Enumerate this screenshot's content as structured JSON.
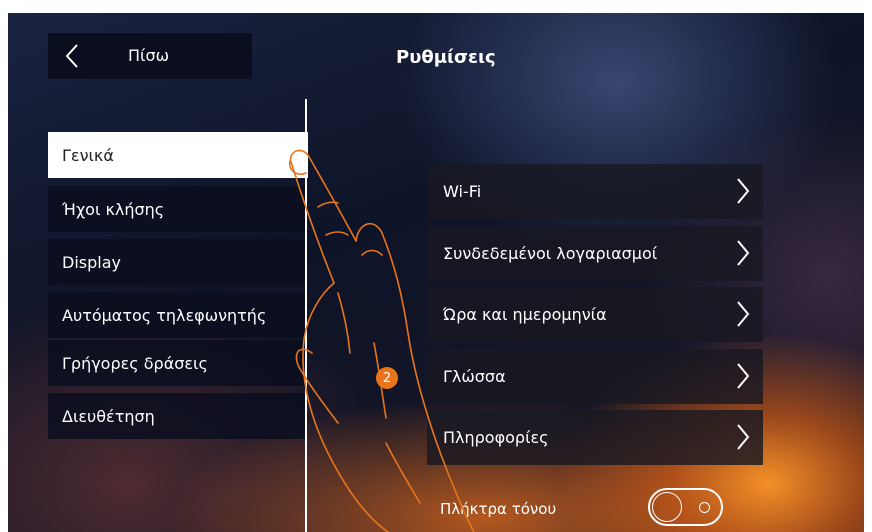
{
  "header": {
    "back_label": "Πίσω",
    "title": "Ρυθμίσεις"
  },
  "sidebar": {
    "items": [
      {
        "label": "Γενικά",
        "active": true
      },
      {
        "label": "Ήχοι κλήσης",
        "active": false
      },
      {
        "label": "Display",
        "active": false
      },
      {
        "label": "Αυτόματος τηλεφωνητής",
        "active": false
      },
      {
        "label": "Γρήγορες δράσεις",
        "active": false
      },
      {
        "label": "Διευθέτηση",
        "active": false
      }
    ]
  },
  "general": {
    "items": [
      {
        "label": "Wi-Fi",
        "icon": "chevron-right-icon"
      },
      {
        "label": "Συνδεδεμένοι λογαριασμοί",
        "icon": "chevron-right-icon"
      },
      {
        "label": "Ώρα και ημερομηνία",
        "icon": "chevron-right-icon"
      },
      {
        "label": "Γλώσσα",
        "icon": "chevron-right-icon"
      },
      {
        "label": "Πληροφορίες",
        "icon": "chevron-right-icon"
      }
    ],
    "keytone": {
      "label": "Πλήκτρα τόνου",
      "enabled": false
    }
  },
  "annotation": {
    "step_number": "2"
  },
  "colors": {
    "accent": "#e8741c",
    "panel": "#0a0e1e",
    "active_item_bg": "#ffffff",
    "text": "#ffffff"
  }
}
